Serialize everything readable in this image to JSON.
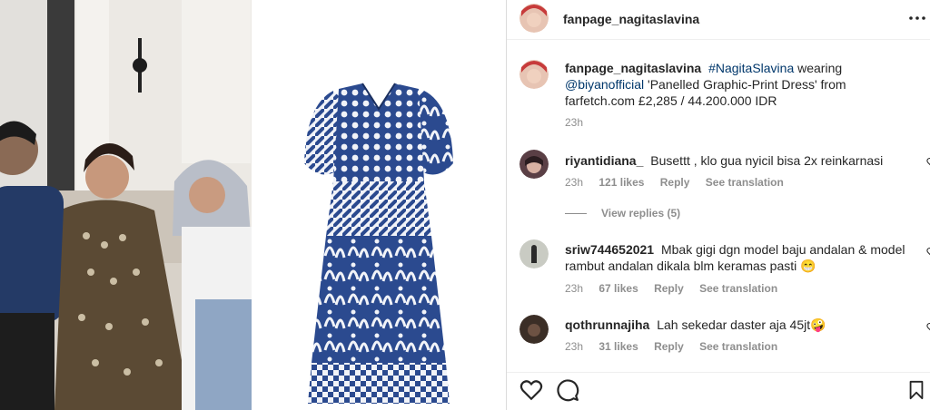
{
  "post": {
    "author": "fanpage_nagitaslavina"
  },
  "caption": {
    "username": "fanpage_nagitaslavina",
    "hashtag": "#NagitaSlavina",
    "word_wearing": "wearing",
    "mention": "@biyanofficial",
    "body": "'Panelled Graphic-Print Dress' from farfetch.com £2,285 / 44.200.000 IDR",
    "time": "23h"
  },
  "comments": [
    {
      "username": "riyantidiana_",
      "text": "Busettt , klo gua nyicil bisa 2x reinkarnasi",
      "time": "23h",
      "likes": "121 likes",
      "reply": "Reply",
      "translate": "See translation"
    },
    {
      "username": "sriw744652021",
      "text": "Mbak gigi dgn model baju andalan & model rambut andalan dikala blm keramas pasti 😁",
      "time": "23h",
      "likes": "67 likes",
      "reply": "Reply",
      "translate": "See translation"
    },
    {
      "username": "qothrunnajiha",
      "text": "Lah sekedar daster aja 45jt🤪",
      "time": "23h",
      "likes": "31 likes",
      "reply": "Reply",
      "translate": "See translation"
    }
  ],
  "view_replies": "View replies (5)",
  "icons": {
    "more": "more-options-icon",
    "like": "heart-icon",
    "comment": "comment-icon",
    "save": "bookmark-icon"
  },
  "colors": {
    "link": "#00376b",
    "muted": "#8e8e8e",
    "text": "#262626",
    "dress_blue": "#2b4a8f"
  }
}
